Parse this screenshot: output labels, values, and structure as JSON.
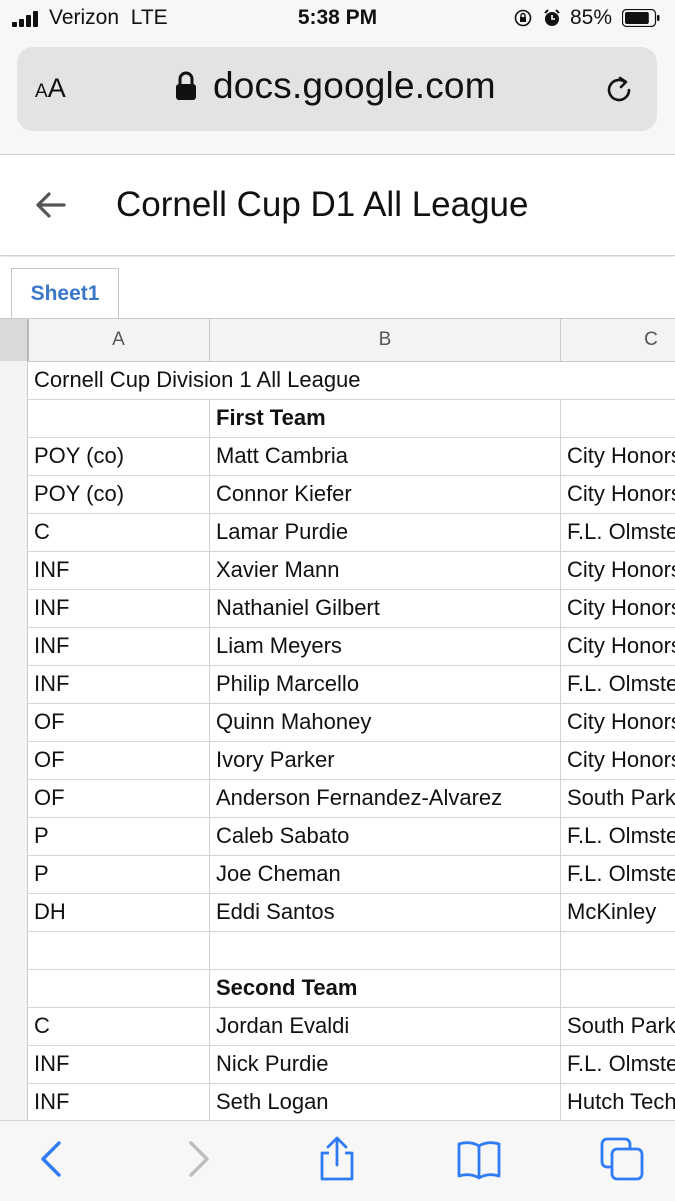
{
  "status_bar": {
    "carrier": "Verizon",
    "network": "LTE",
    "time": "5:38 PM",
    "battery_percent": "85%",
    "battery_level": 0.85,
    "icons": [
      "signal-icon",
      "rotation-lock-icon",
      "alarm-icon",
      "battery-icon"
    ]
  },
  "browser": {
    "reader_label_small": "A",
    "reader_label_large": "A",
    "url": "docs.google.com",
    "icons": [
      "lock-icon",
      "reload-icon"
    ]
  },
  "document": {
    "title": "Cornell Cup D1 All League",
    "back_icon": "back-arrow-icon"
  },
  "sheet_tabs": [
    {
      "label": "Sheet1",
      "active": true
    }
  ],
  "grid": {
    "columns": [
      "A",
      "B",
      "C"
    ],
    "title": "Cornell Cup Division 1 All League",
    "rows": [
      {
        "a": "",
        "b": "First Team",
        "c": "",
        "heading": true
      },
      {
        "a": "POY (co)",
        "b": "Matt Cambria",
        "c": "City Honors"
      },
      {
        "a": "POY (co)",
        "b": "Connor Kiefer",
        "c": "City Honors"
      },
      {
        "a": "C",
        "b": "Lamar Purdie",
        "c": "F.L. Olmsted"
      },
      {
        "a": "INF",
        "b": "Xavier Mann",
        "c": "City Honors"
      },
      {
        "a": "INF",
        "b": "Nathaniel Gilbert",
        "c": "City Honors"
      },
      {
        "a": "INF",
        "b": "Liam Meyers",
        "c": "City Honors"
      },
      {
        "a": "INF",
        "b": "Philip Marcello",
        "c": "F.L. Olmsted"
      },
      {
        "a": "OF",
        "b": "Quinn Mahoney",
        "c": "City Honors"
      },
      {
        "a": "OF",
        "b": "Ivory Parker",
        "c": "City Honors"
      },
      {
        "a": "OF",
        "b": "Anderson Fernandez-Alvarez",
        "c": "South Park"
      },
      {
        "a": "P",
        "b": "Caleb Sabato",
        "c": "F.L. Olmsted"
      },
      {
        "a": "P",
        "b": "Joe Cheman",
        "c": "F.L. Olmsted"
      },
      {
        "a": "DH",
        "b": "Eddi Santos",
        "c": "McKinley"
      },
      {
        "a": "",
        "b": "",
        "c": ""
      },
      {
        "a": "",
        "b": "Second Team",
        "c": "",
        "heading": true
      },
      {
        "a": "C",
        "b": "Jordan Evaldi",
        "c": "South Park"
      },
      {
        "a": "INF",
        "b": "Nick Purdie",
        "c": "F.L. Olmsted"
      },
      {
        "a": "INF",
        "b": "Seth Logan",
        "c": "Hutch Tech"
      }
    ]
  },
  "toolbar": {
    "icons": [
      "back-icon",
      "forward-icon",
      "share-icon",
      "bookmarks-icon",
      "tabs-icon"
    ]
  }
}
